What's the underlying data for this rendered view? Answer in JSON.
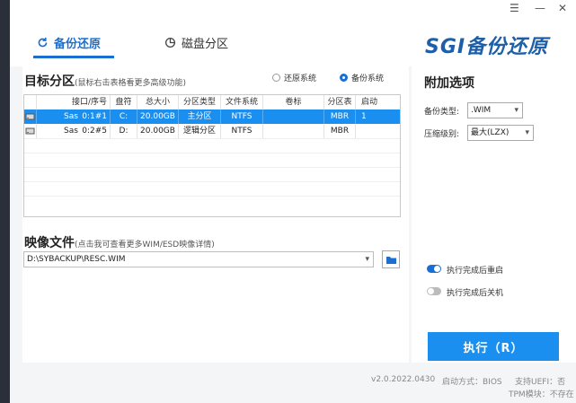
{
  "window": {
    "controls": [
      "☰",
      "—",
      "✕"
    ]
  },
  "tabs": [
    {
      "label": "备份还原",
      "icon": "refresh-icon",
      "active": true
    },
    {
      "label": "磁盘分区",
      "icon": "pie-chart-icon",
      "active": false
    }
  ],
  "brand": {
    "text": "SGI备份还原"
  },
  "target": {
    "title": "目标分区",
    "note": "(鼠标右击表格看更多高级功能)",
    "modes": [
      {
        "label": "还原系统",
        "selected": false
      },
      {
        "label": "备份系统",
        "selected": true
      }
    ]
  },
  "table": {
    "headers": [
      "",
      "接口/序号",
      "盘符",
      "总大小",
      "分区类型",
      "文件系统",
      "卷标",
      "分区表",
      "启动"
    ],
    "rows": [
      {
        "icon": "disk-icon",
        "cells": [
          "Sas",
          "0:1#1",
          "C:",
          "20.00GB",
          "主分区",
          "NTFS",
          "",
          "MBR",
          "1"
        ],
        "selected": true
      },
      {
        "icon": "disk-icon",
        "cells": [
          "Sas",
          "0:2#5",
          "D:",
          "20.00GB",
          "逻辑分区",
          "NTFS",
          "",
          "MBR",
          ""
        ],
        "selected": false
      }
    ]
  },
  "image_file": {
    "title": "映像文件",
    "note": "(点击我可查看更多WIM/ESD映像详情)",
    "path": "D:\\SYBACKUP\\RESC.WIM"
  },
  "options": {
    "title": "附加选项",
    "backup_type_label": "备份类型:",
    "backup_type_value": ".WIM",
    "compress_label": "压缩级别:",
    "compress_value": "最大(LZX)",
    "restart_label": "执行完成后重启",
    "restart_on": true,
    "shutdown_label": "执行完成后关机",
    "shutdown_on": false
  },
  "execute_label": "执行（R）",
  "status": {
    "version": "v2.0.2022.0430",
    "boot_mode": "启动方式：BIOS",
    "uefi": "支持UEFI：否",
    "tpm": "TPM模块：不存在"
  },
  "colors": {
    "accent": "#1a6fd1",
    "selected_row": "#1a8ff0",
    "execute": "#1a8ff0"
  }
}
